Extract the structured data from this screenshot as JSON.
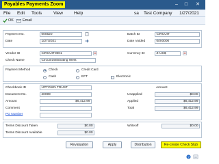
{
  "window": {
    "title": "Payables Payments Zoom"
  },
  "menu": {
    "items": [
      "File",
      "Edit",
      "Tools",
      "View",
      "Help"
    ],
    "user": "sa",
    "company": "Test Company",
    "date": "1/27/2021"
  },
  "toolbar": {
    "ok_label": "OK",
    "email_label": "Email"
  },
  "header": {
    "payment_no_label": "Payment No.",
    "payment_no": "000520",
    "date_label": "Date",
    "date": "1/27/2021",
    "batch_id_label": "Batch ID",
    "batch_id": "CIRCUIT",
    "date_voided_label": "Date Voided",
    "date_voided": "0/0/0000"
  },
  "vendor": {
    "vendor_id_label": "Vendor ID",
    "vendor_id": "CIRCUIT0001",
    "check_name_label": "Check Name",
    "check_name": "Circuit Distributing West",
    "currency_id_label": "Currency ID",
    "currency_id": "Z-US$"
  },
  "payment_method": {
    "label": "Payment Method",
    "options": [
      "Check",
      "Cash",
      "Credit Card",
      "EFT",
      "Electronic"
    ],
    "selected": "Check"
  },
  "details": {
    "checkbook_id_label": "Checkbook ID",
    "checkbook_id": "UPTOWN TRUST",
    "document_no_label": "Document No.",
    "document_no": "20099",
    "amount_label": "Amount",
    "amount": "$6,412.99",
    "comment_label": "Comment",
    "comment": "",
    "po_number_label": "PO Number",
    "po_number": ""
  },
  "amounts": {
    "header": "Amount",
    "unapplied_label": "Unapplied",
    "unapplied": "$0.00",
    "applied_label": "Applied",
    "applied": "$6,412.99",
    "total_label": "Total",
    "total": "$6,412.99"
  },
  "discounts": {
    "taken_label": "Terms Discount Taken",
    "taken": "$0.00",
    "available_label": "Terms Discount Available",
    "available": "$0.00",
    "writeoff_label": "Writeoff",
    "writeoff": "$0.00"
  },
  "buttons": {
    "revaluation": "Revaluation",
    "apply": "Apply",
    "distribution": "Distribution",
    "recreate": "Re-create Check Stub"
  },
  "colors": {
    "titlebar": "#2a5a8c",
    "highlight": "#ffff00",
    "link": "#1a4fd6"
  }
}
